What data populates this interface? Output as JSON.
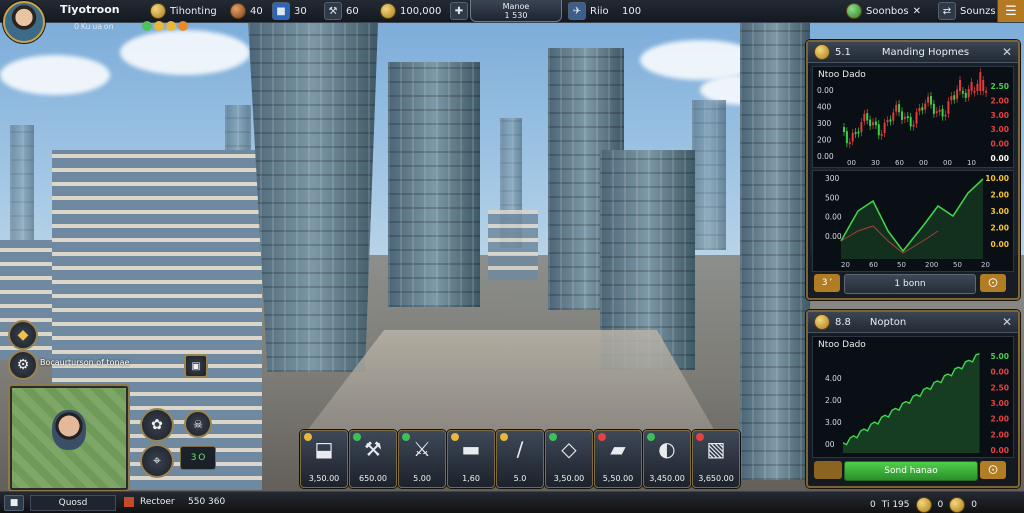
{
  "topbar": {
    "player_name": "Tiyotroon",
    "player_sub": "0 Ku ua on",
    "stats": [
      {
        "icon": "gold-coin-icon",
        "glyph": "●",
        "label": "Tihonting"
      },
      {
        "icon": "bronze-coin-icon",
        "glyph": "●",
        "label": "40"
      },
      {
        "icon": "shield-icon",
        "glyph": "■",
        "label": "30"
      },
      {
        "icon": "wrench-icon",
        "glyph": "⚒",
        "label": "60"
      },
      {
        "icon": "money-bag-icon",
        "glyph": "●",
        "label": "100,000"
      },
      {
        "icon": "tools-icon",
        "glyph": "✖",
        "label": ""
      }
    ],
    "center_title": "Manoe",
    "center_value": "1 530",
    "right_stats": [
      {
        "icon": "plane-icon",
        "label": "Riio"
      },
      {
        "icon": "time-label",
        "label": "100"
      }
    ],
    "status_label": "Soonbos",
    "status_sub": "Sounzs",
    "menu_icon": "menu-icon"
  },
  "panel1": {
    "title_prefix": "5.1",
    "title": "Manding Hopmes",
    "chart1": {
      "title": "Ntoo Dado",
      "y_labels": [
        "0.00",
        "400",
        "300",
        "200",
        "0.00"
      ],
      "right_labels": [
        {
          "t": "2.50",
          "c": "#43d14c"
        },
        {
          "t": "2.00",
          "c": "#e74141"
        },
        {
          "t": "3.00",
          "c": "#e74141"
        },
        {
          "t": "3.00",
          "c": "#e74141"
        },
        {
          "t": "0.00",
          "c": "#e74141"
        },
        {
          "t": "0.00",
          "c": "#ffffff"
        }
      ],
      "x_labels": [
        "00",
        "30",
        "60",
        "00",
        "00",
        "10"
      ]
    },
    "chart2": {
      "title": "",
      "y_labels": [
        "300",
        "500",
        "0.00",
        "0.00"
      ],
      "right_labels": [
        {
          "t": "10.00",
          "c": "#f5c431"
        },
        {
          "t": "2.00",
          "c": "#f5c431"
        },
        {
          "t": "3.00",
          "c": "#f5c431"
        },
        {
          "t": "2.00",
          "c": "#f5c431"
        },
        {
          "t": "0.00",
          "c": "#f5c431"
        }
      ],
      "x_labels": [
        "20",
        "60",
        "50",
        "200",
        "50",
        "20"
      ]
    },
    "btn_left": "3 ’",
    "btn_center": "1 bonn",
    "btn_right": "⨀"
  },
  "panel2": {
    "title_prefix": "8.8",
    "title": "Nopton",
    "chart": {
      "title": "Ntoo Dado",
      "y_labels": [
        "4.00",
        "2.00",
        "3.00",
        "00"
      ],
      "right_labels": [
        {
          "t": "5.00",
          "c": "#43d14c"
        },
        {
          "t": "0.00",
          "c": "#e74141"
        },
        {
          "t": "2.50",
          "c": "#e74141"
        },
        {
          "t": "3.00",
          "c": "#e74141"
        },
        {
          "t": "2.00",
          "c": "#e74141"
        },
        {
          "t": "2.00",
          "c": "#e74141"
        },
        {
          "t": "0.00",
          "c": "#e74141"
        }
      ]
    },
    "btn_center": "Sond hanao",
    "btn_right": "⨀"
  },
  "side": {
    "quest_text": "Bocaurturson of tonae",
    "map_label": "3 O",
    "buttons": [
      {
        "name": "alert-icon",
        "glyph": "◆"
      },
      {
        "name": "settings-icon",
        "glyph": "⚙"
      },
      {
        "name": "pet-icon",
        "glyph": "✿"
      },
      {
        "name": "skull-icon",
        "glyph": "☠"
      },
      {
        "name": "crosshair-icon",
        "glyph": "⌖"
      }
    ]
  },
  "hotbar": [
    {
      "icon": "gold-bars-icon",
      "glyph": "⬓",
      "price": "3,50.00",
      "badge": "#e7b93b"
    },
    {
      "icon": "hammer-icon",
      "glyph": "⚒",
      "price": "650.00",
      "badge": "#3cc15a"
    },
    {
      "icon": "crossed-tools-icon",
      "glyph": "⚔",
      "price": "5.00",
      "badge": "#3cc15a"
    },
    {
      "icon": "car-icon",
      "glyph": "▬",
      "price": "1,60",
      "badge": "#e7b93b"
    },
    {
      "icon": "rail-icon",
      "glyph": "∕",
      "price": "5.0",
      "badge": "#e7b93b"
    },
    {
      "icon": "box-icon",
      "glyph": "◇",
      "price": "3,50.00",
      "badge": "#3cc15a"
    },
    {
      "icon": "brick-icon",
      "glyph": "▰",
      "price": "5,50.00",
      "badge": "#e74141"
    },
    {
      "icon": "paint-icon",
      "glyph": "◐",
      "price": "3,450.00",
      "badge": "#3cc15a"
    },
    {
      "icon": "crate-icon",
      "glyph": "▧",
      "price": "3,650.00",
      "badge": "#e74141"
    }
  ],
  "bottombar": {
    "left_label": "Quosd",
    "center_label": "Rectoer",
    "center_value": "550 360",
    "right_label": "0",
    "right_value": "Ti 195",
    "right_icons": [
      "0",
      "0"
    ]
  }
}
